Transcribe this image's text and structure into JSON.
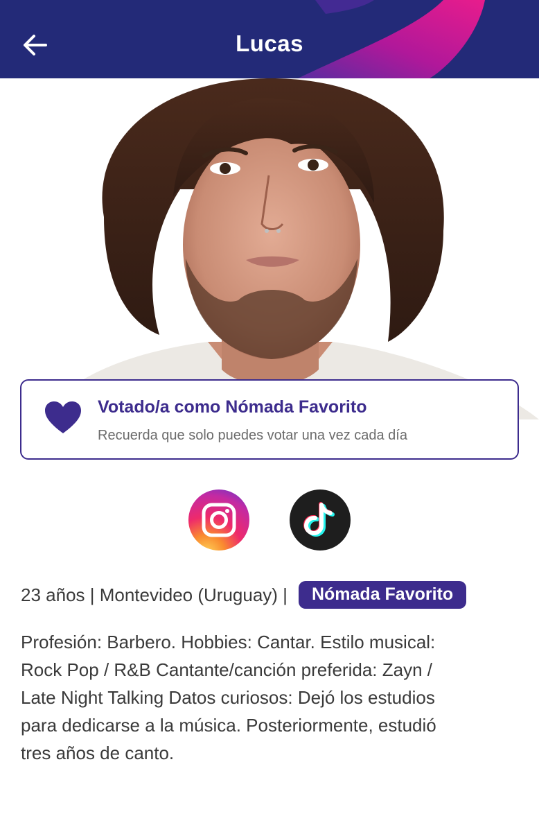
{
  "header": {
    "title": "Lucas",
    "back_icon": "arrow-left-icon",
    "colors": {
      "background": "#232a78",
      "accent_magenta": "#e0168f",
      "accent_purple": "#5a2ca0"
    }
  },
  "photo": {
    "subject": "contestant-portrait"
  },
  "vote": {
    "icon": "heart-icon",
    "title": "Votado/a como Nómada Favorito",
    "subtitle": "Recuerda que solo puedes votar una vez cada día",
    "accent": "#3d2c8d"
  },
  "social": [
    {
      "name": "instagram",
      "icon": "instagram-icon"
    },
    {
      "name": "tiktok",
      "icon": "tiktok-icon"
    }
  ],
  "profile": {
    "info": "23 años | Montevideo (Uruguay) |",
    "badge": "Nómada Favorito",
    "bio": [
      "Profesión: Barbero.  Hobbies: Cantar.  Estilo musical:",
      "Rock Pop / R&B  Cantante/canción preferida: Zayn /",
      "Late Night Talking  Datos curiosos: Dejó los estudios",
      "para dedicarse a la música. Posteriormente, estudió",
      "tres años de canto."
    ]
  }
}
